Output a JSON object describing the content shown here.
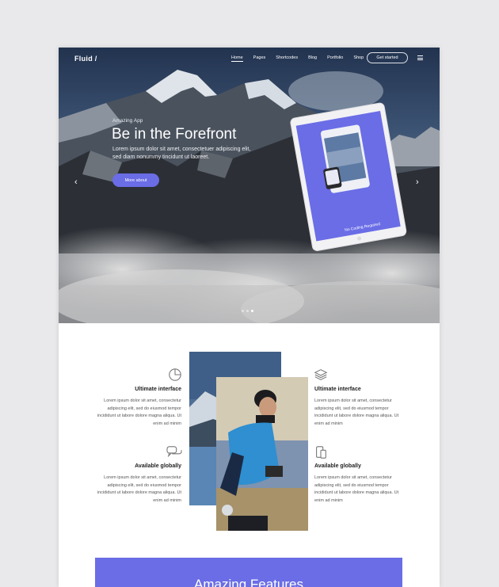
{
  "header": {
    "logo": "Fluid /",
    "nav": [
      "Home",
      "Pages",
      "Shortcodes",
      "Blog",
      "Portfolio",
      "Shop"
    ],
    "active_nav": "Home",
    "cta_label": "Get started"
  },
  "hero": {
    "tagline": "Amazing App",
    "title": "Be in the Forefront",
    "subtitle": "Lorem ipsum dolor sit amet, consectetuer adipiscing elit, sed diam nonummy tincidunt ut laoreet.",
    "button_label": "More about",
    "tablet_text": "No Coding Required",
    "slide_count": 3,
    "active_slide": 2
  },
  "features": [
    {
      "title": "Ultimate interface",
      "icon": "pie-chart-icon",
      "text": "Lorem ipsum dolor sit amet, consectetur adipiscing elit, sed do eiusmod tempor incididunt ut labore dolore magna aliqua. Ut enim ad minim"
    },
    {
      "title": "Ultimate interface",
      "icon": "layers-icon",
      "text": "Lorem ipsum dolor sit amet, consectetur adipiscing elit, sed do eiusmod tempor incididunt ut labore dolore magna aliqua. Ut enim ad minim"
    },
    {
      "title": "Available globally",
      "icon": "chat-bubbles-icon",
      "text": "Lorem ipsum dolor sit amet, consectetur adipiscing elit, sed do eiusmod tempor incididunt ut labore dolore magna aliqua. Ut enim ad minim"
    },
    {
      "title": "Available globally",
      "icon": "mobile-devices-icon",
      "text": "Lorem ipsum dolor sit amet, consectetur adipiscing elit, sed do eiusmod tempor incididunt ut labore dolore magna aliqua. Ut enim ad minim"
    }
  ],
  "banner": {
    "title": "Amazing Features"
  },
  "colors": {
    "accent": "#6a6de6",
    "hero_dark": "#22334f"
  }
}
